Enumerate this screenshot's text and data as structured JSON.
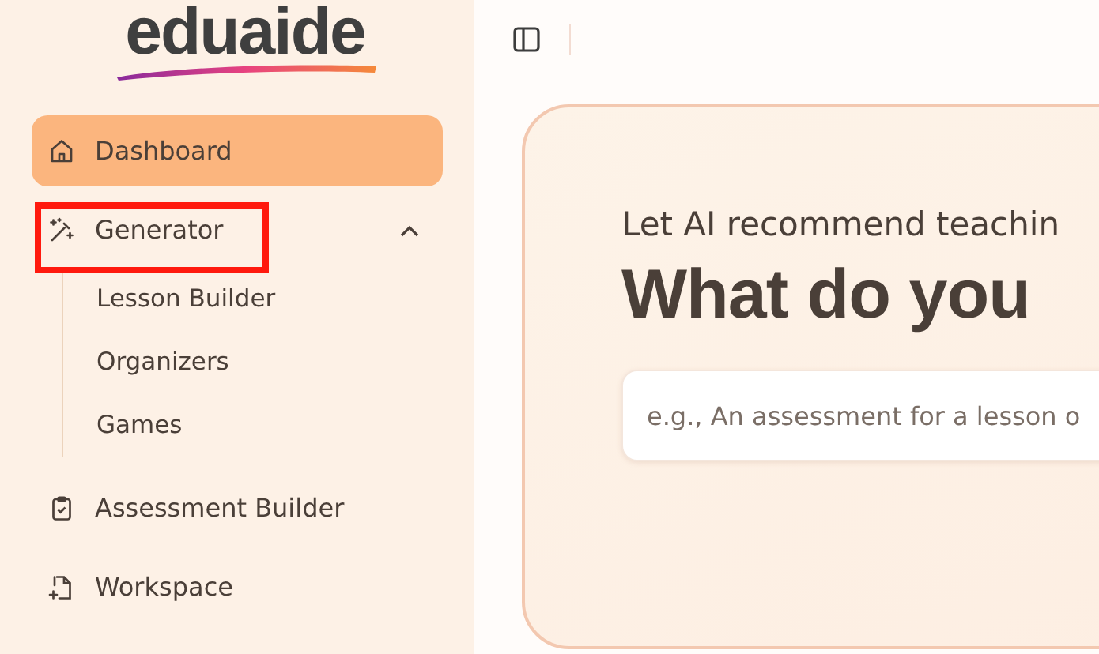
{
  "logo": {
    "text": "eduaide"
  },
  "sidebar": {
    "items": [
      {
        "label": "Dashboard",
        "selected": true,
        "highlighted": false
      },
      {
        "label": "Generator",
        "selected": false,
        "highlighted": true,
        "expanded": true,
        "children": [
          {
            "label": "Lesson Builder"
          },
          {
            "label": "Organizers"
          },
          {
            "label": "Games"
          }
        ]
      },
      {
        "label": "Assessment Builder",
        "selected": false,
        "highlighted": false
      },
      {
        "label": "Workspace",
        "selected": false,
        "highlighted": false
      }
    ]
  },
  "hero": {
    "subtitle": "Let AI recommend teachin",
    "title": "What do you",
    "input": {
      "placeholder": "e.g., An assessment for a lesson o"
    }
  }
}
